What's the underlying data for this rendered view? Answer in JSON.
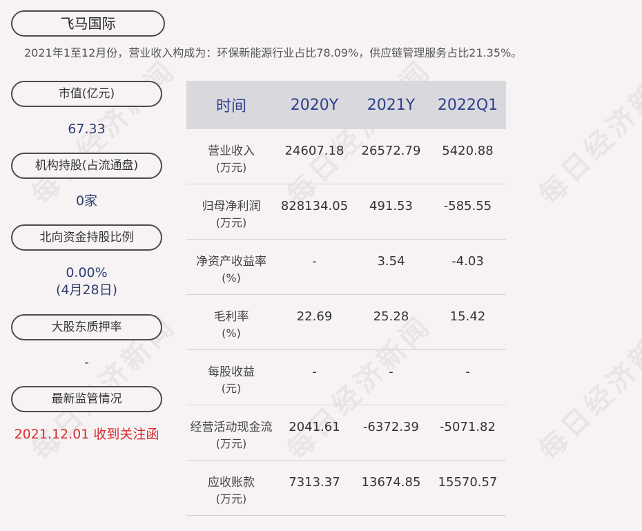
{
  "company": {
    "name": "飞马国际"
  },
  "summary": "2021年1至12月份，营业收入构成为：环保新能源行业占比78.09%，供应链管理服务占比21.35%。",
  "sidebar": [
    {
      "label": "市值(亿元)",
      "value": "67.33"
    },
    {
      "label": "机构持股(占流通盘)",
      "value": "0家"
    },
    {
      "label": "北向资金持股比例",
      "value": "0.00%",
      "value2": "(4月28日)"
    },
    {
      "label": "大股东质押率",
      "value": "-"
    },
    {
      "label": "最新监管情况",
      "value": "2021.12.01 收到关注函"
    }
  ],
  "table": {
    "headers": [
      "时间",
      "2020Y",
      "2021Y",
      "2022Q1"
    ],
    "rows": [
      {
        "label": "营业收入",
        "unit": "(万元)",
        "values": [
          "24607.18",
          "26572.79",
          "5420.88"
        ]
      },
      {
        "label": "归母净利润",
        "unit": "(万元)",
        "values": [
          "828134.05",
          "491.53",
          "-585.55"
        ]
      },
      {
        "label": "净资产收益率",
        "unit": "(%)",
        "values": [
          "-",
          "3.54",
          "-4.03"
        ]
      },
      {
        "label": "毛利率",
        "unit": "(%)",
        "values": [
          "22.69",
          "25.28",
          "15.42"
        ]
      },
      {
        "label": "每股收益",
        "unit": "(元)",
        "values": [
          "-",
          "-",
          "-"
        ]
      },
      {
        "label": "经营活动现金流",
        "unit": "(万元)",
        "values": [
          "2041.61",
          "-6372.39",
          "-5071.82"
        ]
      },
      {
        "label": "应收账款",
        "unit": "(万元)",
        "values": [
          "7313.37",
          "13674.85",
          "15570.57"
        ]
      }
    ]
  },
  "watermark": "每日经济新闻",
  "colors": {
    "accent": "#2d3e8c",
    "alert": "#d62b2b",
    "header_bg": "#d9d9dd"
  }
}
